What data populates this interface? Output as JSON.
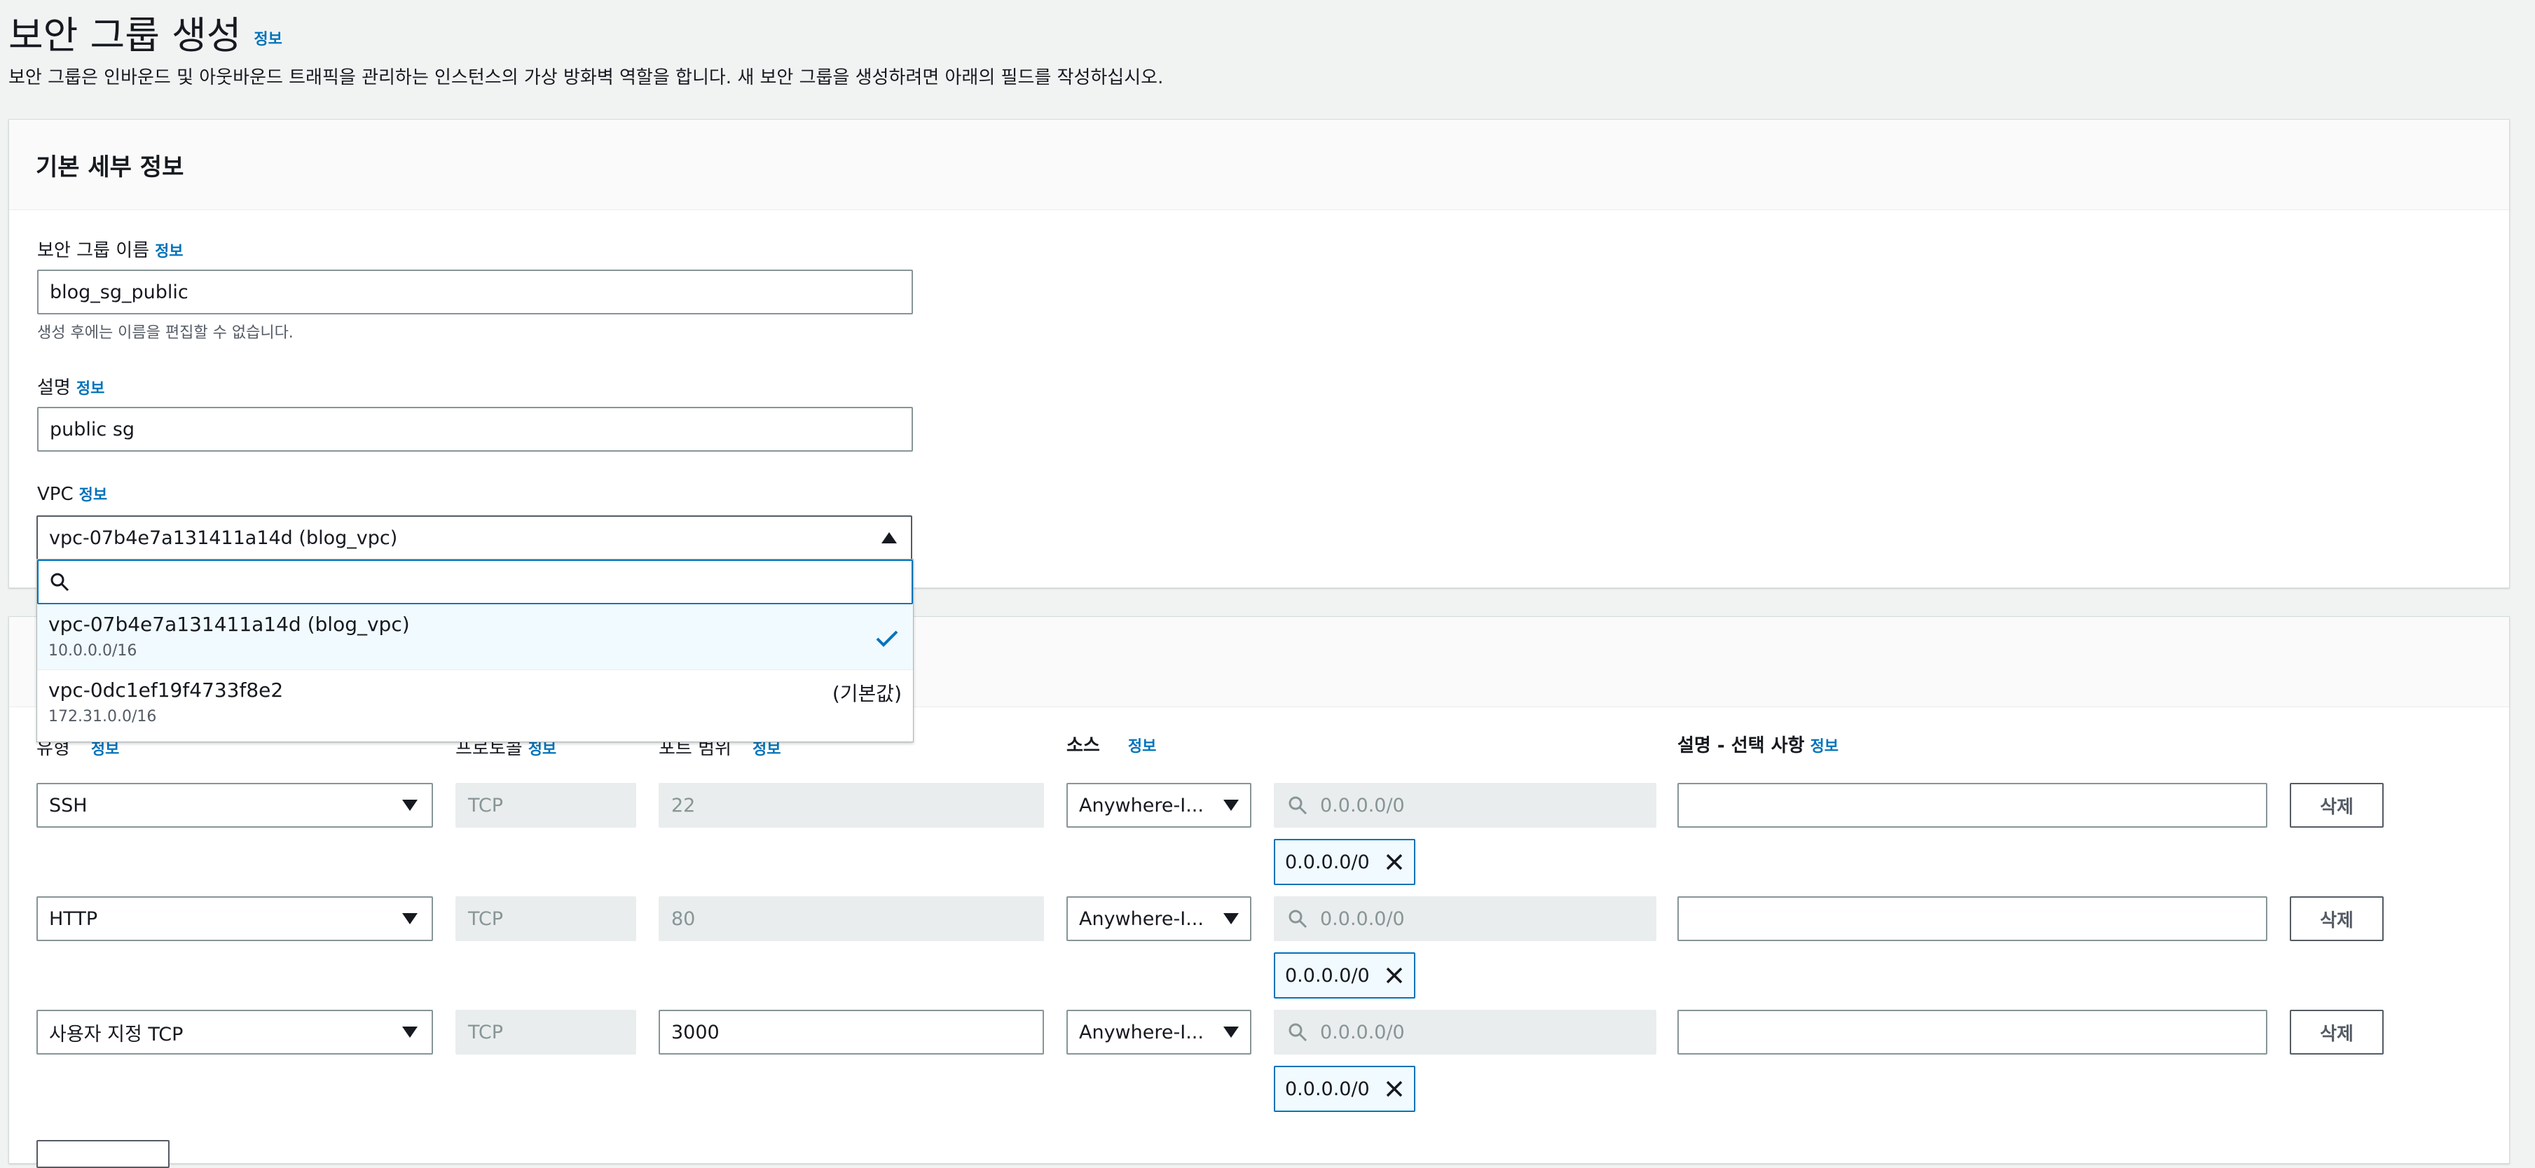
{
  "page": {
    "title": "보안 그룹 생성",
    "info": "정보",
    "description": "보안 그룹은 인바운드 및 아웃바운드 트래픽을 관리하는 인스턴스의 가상 방화벽 역할을 합니다. 새 보안 그룹을 생성하려면 아래의 필드를 작성하십시오."
  },
  "basic": {
    "title": "기본 세부 정보",
    "name_label": "보안 그룹 이름",
    "name_value": "blog_sg_public",
    "name_hint": "생성 후에는 이름을 편집할 수 없습니다.",
    "desc_label": "설명",
    "desc_value": "public sg",
    "vpc_label": "VPC",
    "vpc_value": "vpc-07b4e7a131411a14d (blog_vpc)",
    "vpc_search_placeholder": "",
    "vpc_options": [
      {
        "id": "vpc-07b4e7a131411a14d (blog_vpc)",
        "cidr": "10.0.0.0/16",
        "tag": ""
      },
      {
        "id": "vpc-0dc1ef19f4733f8e2",
        "cidr": "172.31.0.0/16",
        "tag": "(기본값)"
      }
    ]
  },
  "rules": {
    "headers": {
      "type": "유형",
      "protocol": "프로토콜",
      "port": "포트 범위",
      "source": "소스",
      "description": "설명 - 선택 사항"
    },
    "source_search_placeholder": "0.0.0.0/0",
    "delete_label": "삭제",
    "rows": [
      {
        "type": "SSH",
        "protocol": "TCP",
        "port": "22",
        "port_editable": false,
        "source": "Anywhere-I...",
        "cidr": "0.0.0.0/0",
        "desc": ""
      },
      {
        "type": "HTTP",
        "protocol": "TCP",
        "port": "80",
        "port_editable": false,
        "source": "Anywhere-I...",
        "cidr": "0.0.0.0/0",
        "desc": ""
      },
      {
        "type": "사용자 지정 TCP",
        "protocol": "TCP",
        "port": "3000",
        "port_editable": true,
        "source": "Anywhere-I...",
        "cidr": "0.0.0.0/0",
        "desc": ""
      }
    ]
  },
  "colors": {
    "info_link": "#0073bb",
    "selected_bg": "#f1faff",
    "disabled_bg": "#eaeded"
  }
}
